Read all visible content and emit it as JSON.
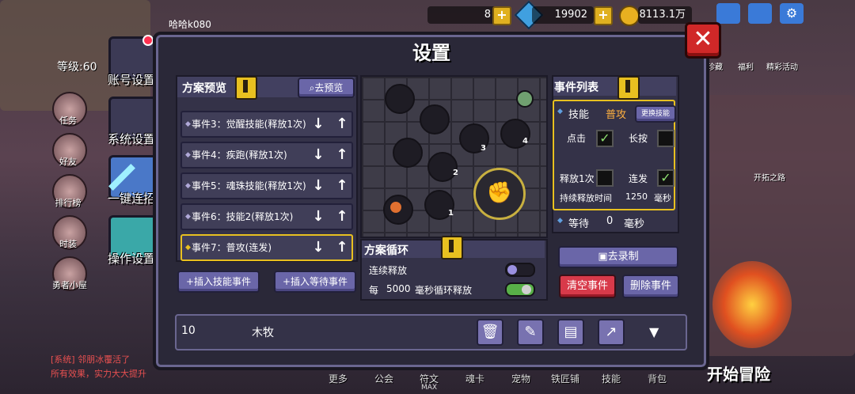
{
  "hud": {
    "player_name": "哈哈k080",
    "level": "等级:60",
    "count1": "8",
    "gems": "19902",
    "gold": "8113.1万",
    "bottom_status": "MAX",
    "start_adventure": "开始冒险",
    "log_line1": "[系统] 邻朋冰覆活了",
    "log_line2": "所有效果，实力大大提升",
    "left_menu": [
      "任务",
      "好友",
      "排行榜",
      "时装",
      "勇者小屋"
    ],
    "right_menu": [
      "珍藏",
      "福利",
      "精彩活动",
      "开拓之路"
    ],
    "nav_tabs": [
      "更多",
      "公会",
      "符文",
      "魂卡",
      "宠物",
      "铁匠铺",
      "技能",
      "背包"
    ]
  },
  "settings": {
    "title": "设置",
    "side_tabs": [
      "账号设置",
      "系统设置",
      "一键连招",
      "操作设置"
    ],
    "preview": {
      "title": "方案预览",
      "goto_preview": "去预览",
      "events": [
        "事件3：觉醒技能(释放1次)",
        "事件4：疾跑(释放1次)",
        "事件5：魂珠技能(释放1次)",
        "事件6：技能2(释放1次)",
        "事件7：普攻(连发)"
      ],
      "insert_skill": "插入技能事件",
      "insert_wait": "插入等待事件"
    },
    "map_nodes": [
      "1",
      "2",
      "3",
      "4"
    ],
    "loop": {
      "title": "方案循环",
      "continuous": "连续释放",
      "every": "每",
      "ms_value": "5000",
      "ms_suffix": "毫秒循环释放"
    },
    "event_list": {
      "title": "事件列表",
      "skill_label": "技能",
      "skill_value": "普攻",
      "change_skill": "更换技能",
      "tap": "点击",
      "hold": "长按",
      "once": "释放1次",
      "burst": "连发",
      "duration_label": "持续释放时间",
      "duration_value": "1250",
      "duration_unit": "毫秒",
      "wait_label": "等待",
      "wait_value": "0",
      "wait_unit": "毫秒"
    },
    "record_btn": "去录制",
    "clear_btn": "清空事件",
    "delete_btn": "删除事件",
    "scheme_number": "10",
    "scheme_name": "木牧"
  }
}
